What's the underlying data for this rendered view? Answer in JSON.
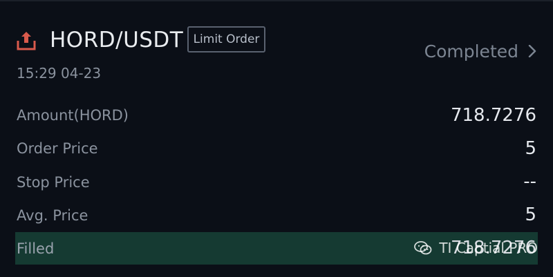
{
  "order": {
    "pair": "HORD/USDT",
    "type_badge": "Limit Order",
    "time": "15:29 04-23",
    "status": "Completed"
  },
  "rows": [
    {
      "label": "Amount(HORD)",
      "value": "718.7276"
    },
    {
      "label": "Order Price",
      "value": "5"
    },
    {
      "label": "Stop Price",
      "value": "--"
    },
    {
      "label": "Avg. Price",
      "value": "5"
    }
  ],
  "filled": {
    "label": "Filled",
    "value": "718.7276"
  },
  "watermark": {
    "text": "TI Captial PRO"
  },
  "icons": {
    "order": "upload-icon",
    "status": "chevron-right-icon",
    "watermark": "wechat-icon"
  },
  "colors": {
    "accent": "#d95a4c",
    "filled_bar": "#153a32",
    "background": "#0b0f17"
  }
}
